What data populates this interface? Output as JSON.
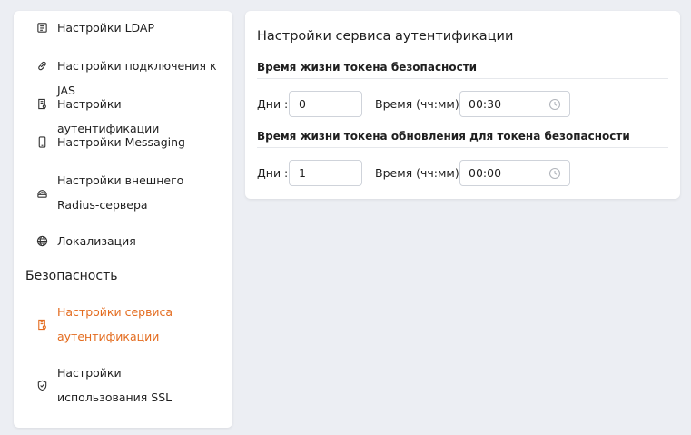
{
  "sidebar": {
    "items": [
      {
        "label": "Настройки LDAP",
        "icon": "ldap-icon"
      },
      {
        "label": "Настройки подключения к JAS",
        "icon": "link-icon"
      },
      {
        "label": "Настройки аутентификации",
        "icon": "auth-document-icon"
      },
      {
        "label": "Настройки Messaging",
        "icon": "mobile-phone-icon"
      },
      {
        "label": "Настройки внешнего Radius-сервера",
        "icon": "radius-server-icon"
      },
      {
        "label": "Локализация",
        "icon": "globe-icon"
      }
    ],
    "section_title": "Безопасность",
    "security_items": [
      {
        "label": "Настройки сервиса аутентификации",
        "icon": "auth-service-icon",
        "active": true
      },
      {
        "label": "Настройки использования SSL",
        "icon": "shield-icon",
        "active": false
      }
    ]
  },
  "panel": {
    "title": "Настройки сервиса аутентификации",
    "token_lifetime": {
      "title": "Время жизни токена безопасности",
      "days_label": "Дни :",
      "days_value": "0",
      "time_label": "Время (чч:мм) :",
      "time_value": "00:30"
    },
    "refresh_lifetime": {
      "title": "Время жизни токена обновления для токена безопасности",
      "days_label": "Дни :",
      "days_value": "1",
      "time_label": "Время (чч:мм) :",
      "time_value": "00:00"
    }
  },
  "colors": {
    "accent": "#e36b1e",
    "background": "#eceef3",
    "card": "#ffffff"
  }
}
